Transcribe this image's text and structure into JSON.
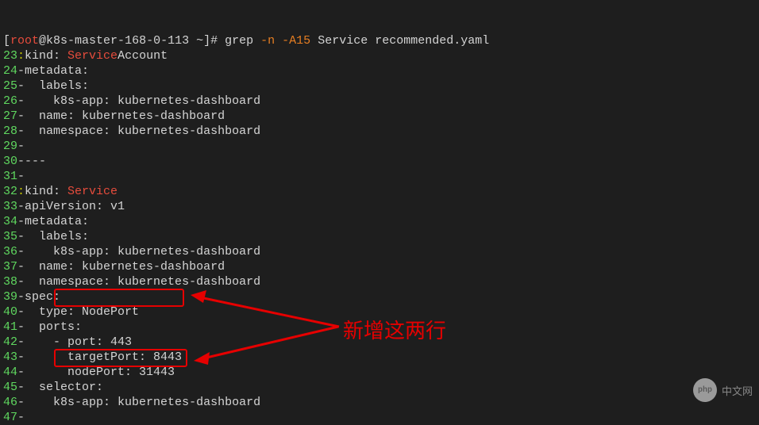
{
  "prompt": {
    "user": "root",
    "host": "k8s-master-168-0-113",
    "path": "~",
    "command": "grep",
    "args_flag": "-n -A15",
    "args_rest": "Service recommended.yaml"
  },
  "lines": [
    {
      "num": "23",
      "sep": ":",
      "pre": "kind: ",
      "hl": "Service",
      "post": "Account"
    },
    {
      "num": "24",
      "sep": "-",
      "pre": "metadata:",
      "hl": "",
      "post": ""
    },
    {
      "num": "25",
      "sep": "-",
      "pre": "  labels:",
      "hl": "",
      "post": ""
    },
    {
      "num": "26",
      "sep": "-",
      "pre": "    k8s-app: kubernetes-dashboard",
      "hl": "",
      "post": ""
    },
    {
      "num": "27",
      "sep": "-",
      "pre": "  name: kubernetes-dashboard",
      "hl": "",
      "post": ""
    },
    {
      "num": "28",
      "sep": "-",
      "pre": "  namespace: kubernetes-dashboard",
      "hl": "",
      "post": ""
    },
    {
      "num": "29",
      "sep": "-",
      "pre": "",
      "hl": "",
      "post": ""
    },
    {
      "num": "30",
      "sep": "-",
      "pre": "---",
      "hl": "",
      "post": ""
    },
    {
      "num": "31",
      "sep": "-",
      "pre": "",
      "hl": "",
      "post": ""
    },
    {
      "num": "32",
      "sep": ":",
      "pre": "kind: ",
      "hl": "Service",
      "post": ""
    },
    {
      "num": "33",
      "sep": "-",
      "pre": "apiVersion: v1",
      "hl": "",
      "post": ""
    },
    {
      "num": "34",
      "sep": "-",
      "pre": "metadata:",
      "hl": "",
      "post": ""
    },
    {
      "num": "35",
      "sep": "-",
      "pre": "  labels:",
      "hl": "",
      "post": ""
    },
    {
      "num": "36",
      "sep": "-",
      "pre": "    k8s-app: kubernetes-dashboard",
      "hl": "",
      "post": ""
    },
    {
      "num": "37",
      "sep": "-",
      "pre": "  name: kubernetes-dashboard",
      "hl": "",
      "post": ""
    },
    {
      "num": "38",
      "sep": "-",
      "pre": "  namespace: kubernetes-dashboard",
      "hl": "",
      "post": ""
    },
    {
      "num": "39",
      "sep": "-",
      "pre": "spec:",
      "hl": "",
      "post": ""
    },
    {
      "num": "40",
      "sep": "-",
      "pre": "  type: NodePort",
      "hl": "",
      "post": ""
    },
    {
      "num": "41",
      "sep": "-",
      "pre": "  ports:",
      "hl": "",
      "post": ""
    },
    {
      "num": "42",
      "sep": "-",
      "pre": "    - port: 443",
      "hl": "",
      "post": ""
    },
    {
      "num": "43",
      "sep": "-",
      "pre": "      targetPort: 8443",
      "hl": "",
      "post": ""
    },
    {
      "num": "44",
      "sep": "-",
      "pre": "      nodePort: 31443",
      "hl": "",
      "post": ""
    },
    {
      "num": "45",
      "sep": "-",
      "pre": "  selector:",
      "hl": "",
      "post": ""
    },
    {
      "num": "46",
      "sep": "-",
      "pre": "    k8s-app: kubernetes-dashboard",
      "hl": "",
      "post": ""
    },
    {
      "num": "47",
      "sep": "-",
      "pre": "",
      "hl": "",
      "post": ""
    }
  ],
  "annotation": "新增这两行",
  "watermark": {
    "badge": "php",
    "text": "中文网"
  }
}
